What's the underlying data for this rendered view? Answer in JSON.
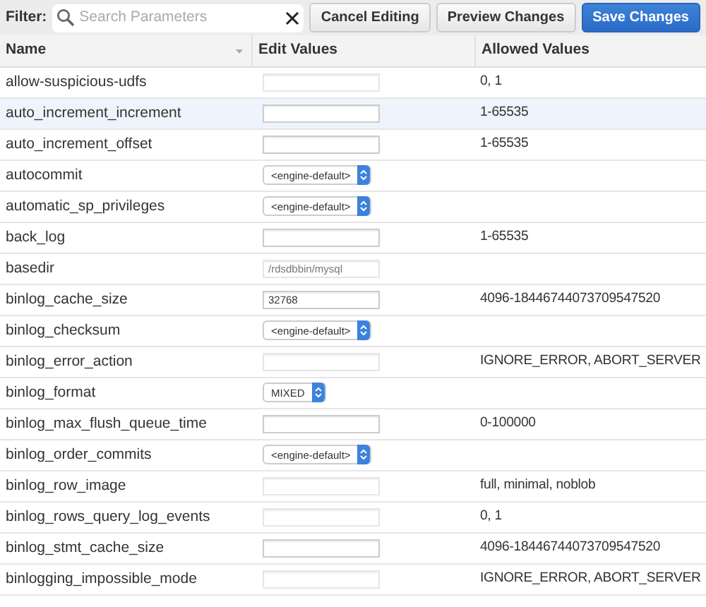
{
  "toolbar": {
    "filter_label": "Filter:",
    "search": {
      "placeholder": "Search Parameters"
    },
    "buttons": [
      {
        "label": "Cancel Editing",
        "kind": "default"
      },
      {
        "label": "Preview Changes",
        "kind": "default"
      },
      {
        "label": "Save Changes",
        "kind": "primary"
      }
    ]
  },
  "table": {
    "columns": [
      "Name",
      "Edit Values",
      "Allowed Values"
    ],
    "rows": [
      {
        "name": "allow-suspicious-udfs",
        "selected": false,
        "field": {
          "kind": "text",
          "disabled": true
        },
        "allowed": "0, 1"
      },
      {
        "name": "auto_increment_increment",
        "selected": true,
        "field": {
          "kind": "text",
          "disabled": false
        },
        "allowed": "1-65535"
      },
      {
        "name": "auto_increment_offset",
        "selected": false,
        "field": {
          "kind": "text",
          "disabled": false
        },
        "allowed": "1-65535"
      },
      {
        "name": "autocommit",
        "selected": false,
        "field": {
          "kind": "select",
          "value": "<engine-default>"
        }
      },
      {
        "name": "automatic_sp_privileges",
        "selected": false,
        "field": {
          "kind": "select",
          "value": "<engine-default>"
        }
      },
      {
        "name": "back_log",
        "selected": false,
        "field": {
          "kind": "text",
          "disabled": false
        },
        "allowed": "1-65535"
      },
      {
        "name": "basedir",
        "selected": false,
        "field": {
          "kind": "text",
          "disabled": true,
          "value": "/rdsdbbin/mysql"
        }
      },
      {
        "name": "binlog_cache_size",
        "selected": false,
        "field": {
          "kind": "text",
          "disabled": false,
          "value": "32768"
        },
        "allowed": "4096-18446744073709547520"
      },
      {
        "name": "binlog_checksum",
        "selected": false,
        "field": {
          "kind": "select",
          "value": "<engine-default>"
        }
      },
      {
        "name": "binlog_error_action",
        "selected": false,
        "field": {
          "kind": "text",
          "disabled": true
        },
        "allowed": "IGNORE_ERROR, ABORT_SERVER"
      },
      {
        "name": "binlog_format",
        "selected": false,
        "field": {
          "kind": "select",
          "value": "MIXED"
        }
      },
      {
        "name": "binlog_max_flush_queue_time",
        "selected": false,
        "field": {
          "kind": "text",
          "disabled": false
        },
        "allowed": "0-100000"
      },
      {
        "name": "binlog_order_commits",
        "selected": false,
        "field": {
          "kind": "select",
          "value": "<engine-default>"
        }
      },
      {
        "name": "binlog_row_image",
        "selected": false,
        "field": {
          "kind": "text",
          "disabled": true
        },
        "allowed": "full, minimal, noblob"
      },
      {
        "name": "binlog_rows_query_log_events",
        "selected": false,
        "field": {
          "kind": "text",
          "disabled": true
        },
        "allowed": "0, 1"
      },
      {
        "name": "binlog_stmt_cache_size",
        "selected": false,
        "field": {
          "kind": "text",
          "disabled": false
        },
        "allowed": "4096-18446744073709547520"
      },
      {
        "name": "binlogging_impossible_mode",
        "selected": false,
        "field": {
          "kind": "text",
          "disabled": true
        },
        "allowed": "IGNORE_ERROR, ABORT_SERVER"
      }
    ]
  }
}
